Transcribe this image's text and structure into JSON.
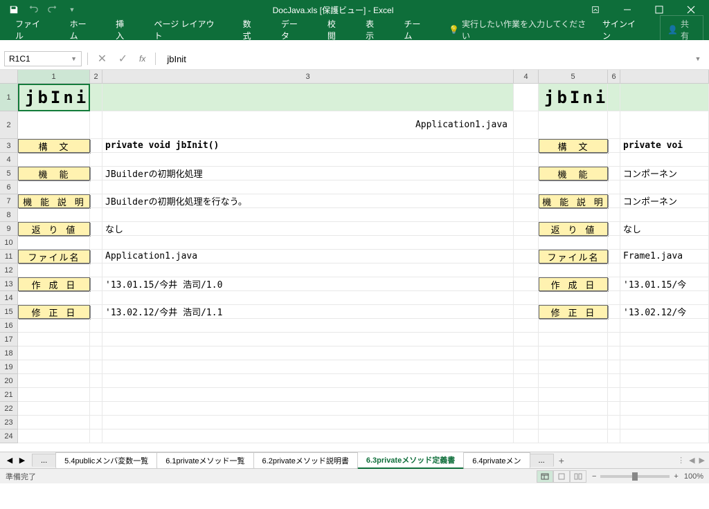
{
  "title": {
    "file": "DocJava.xls",
    "view": "[保護ビュー]",
    "app": "Excel"
  },
  "qat": {
    "save": "保存",
    "undo": "元に戻す",
    "redo": "やり直し",
    "customize": "▾"
  },
  "ribbon": {
    "tabs": [
      "ファイル",
      "ホーム",
      "挿入",
      "ページ レイアウト",
      "数式",
      "データ",
      "校閲",
      "表示",
      "チーム"
    ],
    "tellme_icon": "💡",
    "tellme": "実行したい作業を入力してください",
    "signin": "サインイン",
    "share": "共有"
  },
  "fbar": {
    "name": "R1C1",
    "cancel": "✕",
    "enter": "✓",
    "fx": "fx",
    "formula": "jbInit"
  },
  "cols": [
    "1",
    "2",
    "3",
    "4",
    "5",
    "6"
  ],
  "rows": [
    "1",
    "2",
    "3",
    "4",
    "5",
    "6",
    "7",
    "8",
    "9",
    "10",
    "11",
    "12",
    "13",
    "14",
    "15",
    "16",
    "17",
    "18",
    "19",
    "20",
    "21",
    "22",
    "23",
    "24"
  ],
  "sheet": {
    "header1": "jbInit",
    "header2": "jbInit",
    "filename": "Application1.java",
    "labels": {
      "syntax": "構　文",
      "func": "機　能",
      "desc": "機 能 説 明",
      "ret": "返 り 値",
      "file": "ファイル名",
      "created": "作 成 日",
      "modified": "修 正 日"
    },
    "values": {
      "syntax": "private void jbInit()",
      "func": "JBuilderの初期化処理",
      "desc": "JBuilderの初期化処理を行なう。",
      "ret": "なし",
      "file": "Application1.java",
      "created": "'13.01.15/今井 浩司/1.0",
      "modified": "'13.02.12/今井 浩司/1.1"
    },
    "values2": {
      "syntax": "private voi",
      "func": "コンポーネン",
      "desc": "コンポーネン",
      "ret": "なし",
      "file": "Frame1.java",
      "created": "'13.01.15/今",
      "modified": "'13.02.12/今"
    }
  },
  "tabs": {
    "ellipsis": "...",
    "items": [
      "5.4publicメンバ変数一覧",
      "6.1privateメソッド一覧",
      "6.2privateメソッド説明書",
      "6.3privateメソッド定義書",
      "6.4privateメン"
    ],
    "active_index": 3,
    "add": "+"
  },
  "status": {
    "ready": "準備完了",
    "zoom": "100%"
  }
}
